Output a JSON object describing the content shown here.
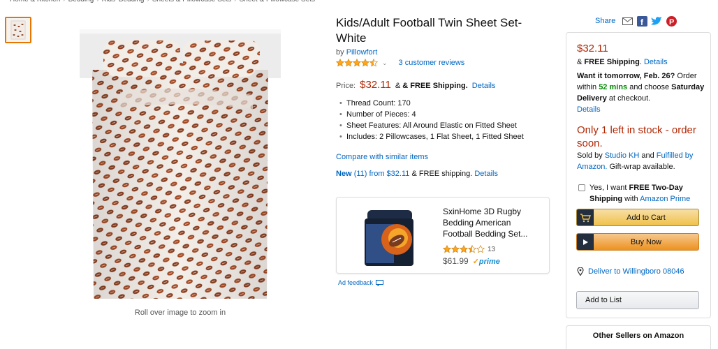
{
  "breadcrumb": [
    "Home & Kitchen",
    "Bedding",
    "Kids' Bedding",
    "Sheets & Pillowcase Sets",
    "Sheet & Pillowcase Sets"
  ],
  "image": {
    "zoom_hint": "Roll over image to zoom in"
  },
  "product": {
    "title": "Kids/Adult Football Twin Sheet Set-White",
    "by_label": "by",
    "brand": "Pillowfort",
    "rating": 4.5,
    "reviews": "3 customer reviews",
    "price_label": "Price:",
    "price": "$32.11",
    "free_shipping": "& FREE Shipping.",
    "details": "Details",
    "bullets": [
      "Thread Count: 170",
      "Number of Pieces: 4",
      "Sheet Features: All Around Elastic on Fitted Sheet",
      "Includes: 2 Pillowcases, 1 Flat Sheet, 1 Fitted Sheet"
    ],
    "compare": "Compare with similar items",
    "new_offers_link": "New (11) from $32.11",
    "new_offers_suffix": "& FREE shipping.",
    "new_offers_details": "Details"
  },
  "ad": {
    "title": "SxinHome 3D Rugby Bedding American Football Bedding Set...",
    "rating": 3.5,
    "rating_count": "13",
    "price": "$61.99",
    "prime": "prime",
    "feedback": "Ad feedback"
  },
  "share": {
    "label": "Share"
  },
  "buybox": {
    "price": "$32.11",
    "shipping_prefix": "& ",
    "shipping": "FREE Shipping",
    "shipping_details": "Details",
    "delivery_lead": "Want it tomorrow, Feb. 26?",
    "delivery_order": "Order within",
    "delivery_time": "52 mins",
    "delivery_choose": "and choose",
    "delivery_option": "Saturday Delivery",
    "delivery_checkout": "at checkout.",
    "delivery_details": "Details",
    "stock": "Only 1 left in stock - order soon.",
    "sold_by_prefix": "Sold by",
    "seller": "Studio KH",
    "and": "and",
    "fulfilled": "Fulfilled by Amazon.",
    "gift": "Gift-wrap available.",
    "prime_prefix": "Yes, I want",
    "prime_bold": "FREE Two-Day Shipping",
    "prime_with": "with",
    "prime_link": "Amazon Prime",
    "add_to_cart": "Add to Cart",
    "buy_now": "Buy Now",
    "deliver_to": "Deliver to Willingboro 08046",
    "add_to_list": "Add to List"
  },
  "other_sellers": {
    "title": "Other Sellers on Amazon"
  },
  "colors": {
    "link": "#0066c0",
    "price": "#b12704",
    "star": "#ffa41c",
    "cart_button": "#f0c14b",
    "buy_button": "#ed9220"
  }
}
